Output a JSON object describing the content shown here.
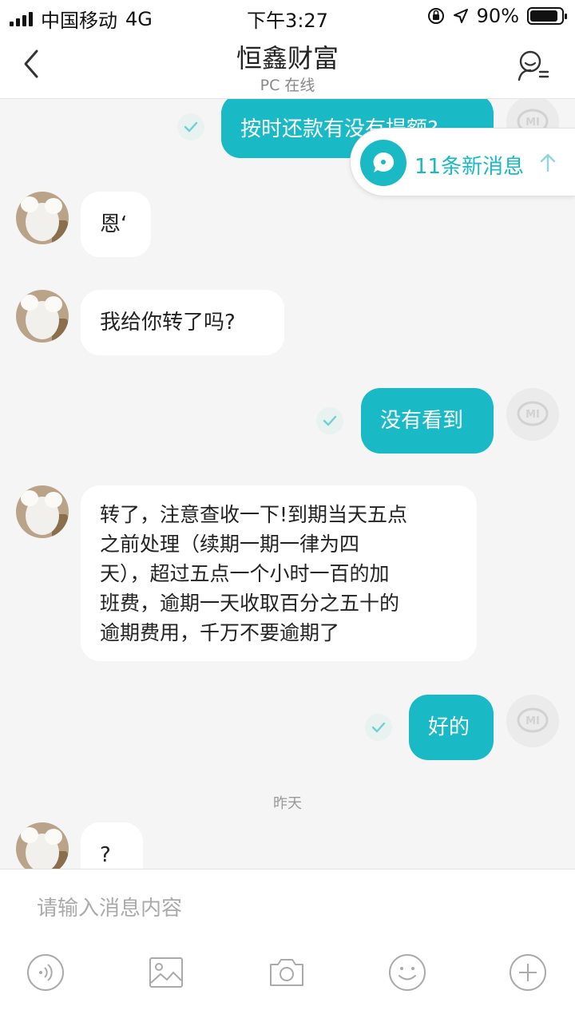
{
  "status_bar": {
    "carrier": "中国移动",
    "network": "4G",
    "time": "下午3:27",
    "battery": "90%",
    "battery_level": 0.9
  },
  "header": {
    "title": "恒鑫财富",
    "subtitle": "PC 在线",
    "back_icon": "chevron-left-icon",
    "profile_icon": "user-list-icon"
  },
  "new_messages": {
    "label": "11条新消息"
  },
  "messages": [
    {
      "side": "right",
      "text": "按时还款有没有提额?"
    },
    {
      "side": "left",
      "text": "恩‘"
    },
    {
      "side": "left",
      "text": "我给你转了吗?"
    },
    {
      "side": "right",
      "text": "没有看到"
    },
    {
      "side": "left",
      "lines": [
        "转了，注意查收一下!到期当天五点",
        "之前处理（续期一期一律为四",
        "天），超过五点一个小时一百的加",
        "班费，逾期一天收取百分之五十的",
        "逾期费用，千万不要逾期了"
      ]
    },
    {
      "side": "right",
      "text": "好的"
    },
    {
      "side": "left",
      "text": "?"
    }
  ],
  "time_separator": "昨天",
  "input": {
    "placeholder": "请输入消息内容"
  },
  "toolbar": [
    "voice-icon",
    "image-icon",
    "camera-icon",
    "emoji-icon",
    "plus-icon"
  ],
  "colors": {
    "accent": "#19b9c6",
    "background": "#f5f5f5",
    "bubble_in": "#ffffff"
  }
}
